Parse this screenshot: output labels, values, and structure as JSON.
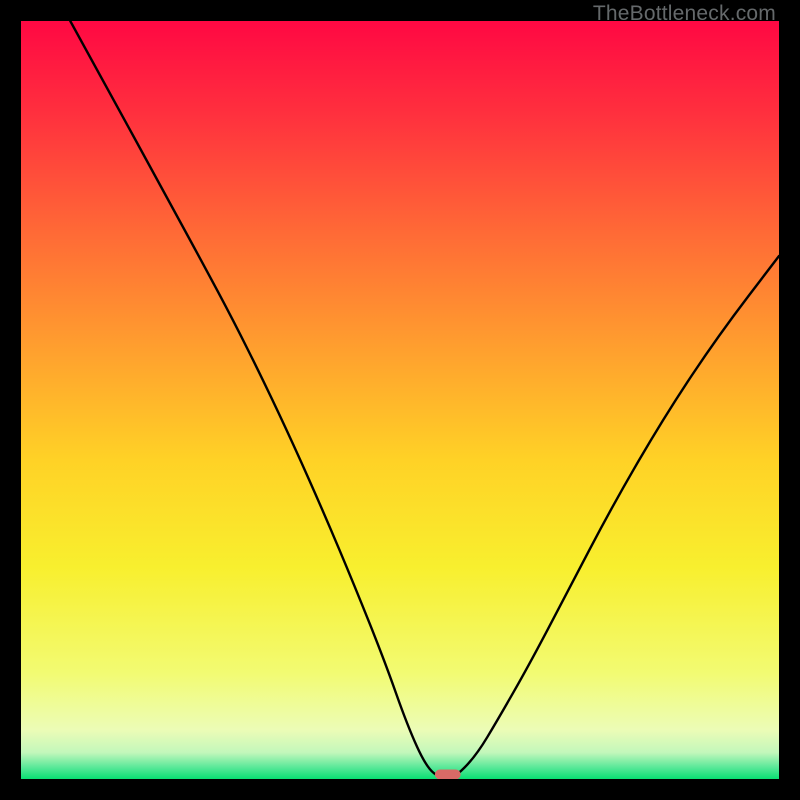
{
  "watermark": {
    "text": "TheBottleneck.com"
  },
  "chart_data": {
    "type": "line",
    "title": "",
    "xlabel": "",
    "ylabel": "",
    "xlim": [
      0,
      100
    ],
    "ylim": [
      0,
      100
    ],
    "grid": false,
    "background_gradient": {
      "stops": [
        {
          "pos": 0.0,
          "color": "#ff0843"
        },
        {
          "pos": 0.12,
          "color": "#ff2f3e"
        },
        {
          "pos": 0.28,
          "color": "#ff6a36"
        },
        {
          "pos": 0.44,
          "color": "#ffa22e"
        },
        {
          "pos": 0.58,
          "color": "#ffd226"
        },
        {
          "pos": 0.72,
          "color": "#f8ef2e"
        },
        {
          "pos": 0.86,
          "color": "#f2fb72"
        },
        {
          "pos": 0.935,
          "color": "#ecfcb6"
        },
        {
          "pos": 0.965,
          "color": "#c3f7bb"
        },
        {
          "pos": 0.985,
          "color": "#57e898"
        },
        {
          "pos": 1.0,
          "color": "#09df72"
        }
      ]
    },
    "series": [
      {
        "name": "bottleneck-curve",
        "color": "#000000",
        "x": [
          6.5,
          12,
          18,
          24,
          28,
          32,
          36,
          40,
          44,
          48,
          51,
          53.5,
          55.5,
          57,
          60,
          63,
          67,
          72,
          78,
          85,
          92,
          100
        ],
        "y": [
          100,
          90,
          79,
          68,
          60.5,
          52.5,
          44,
          35,
          25.5,
          15.5,
          7,
          1.5,
          0,
          0,
          3,
          8,
          15,
          24.5,
          36,
          48,
          58.5,
          69
        ]
      }
    ],
    "marker": {
      "name": "optimal-marker",
      "x": 56.3,
      "y": 0.6,
      "width_pct": 3.4,
      "height_pct": 1.3,
      "color": "#d96a66"
    }
  }
}
